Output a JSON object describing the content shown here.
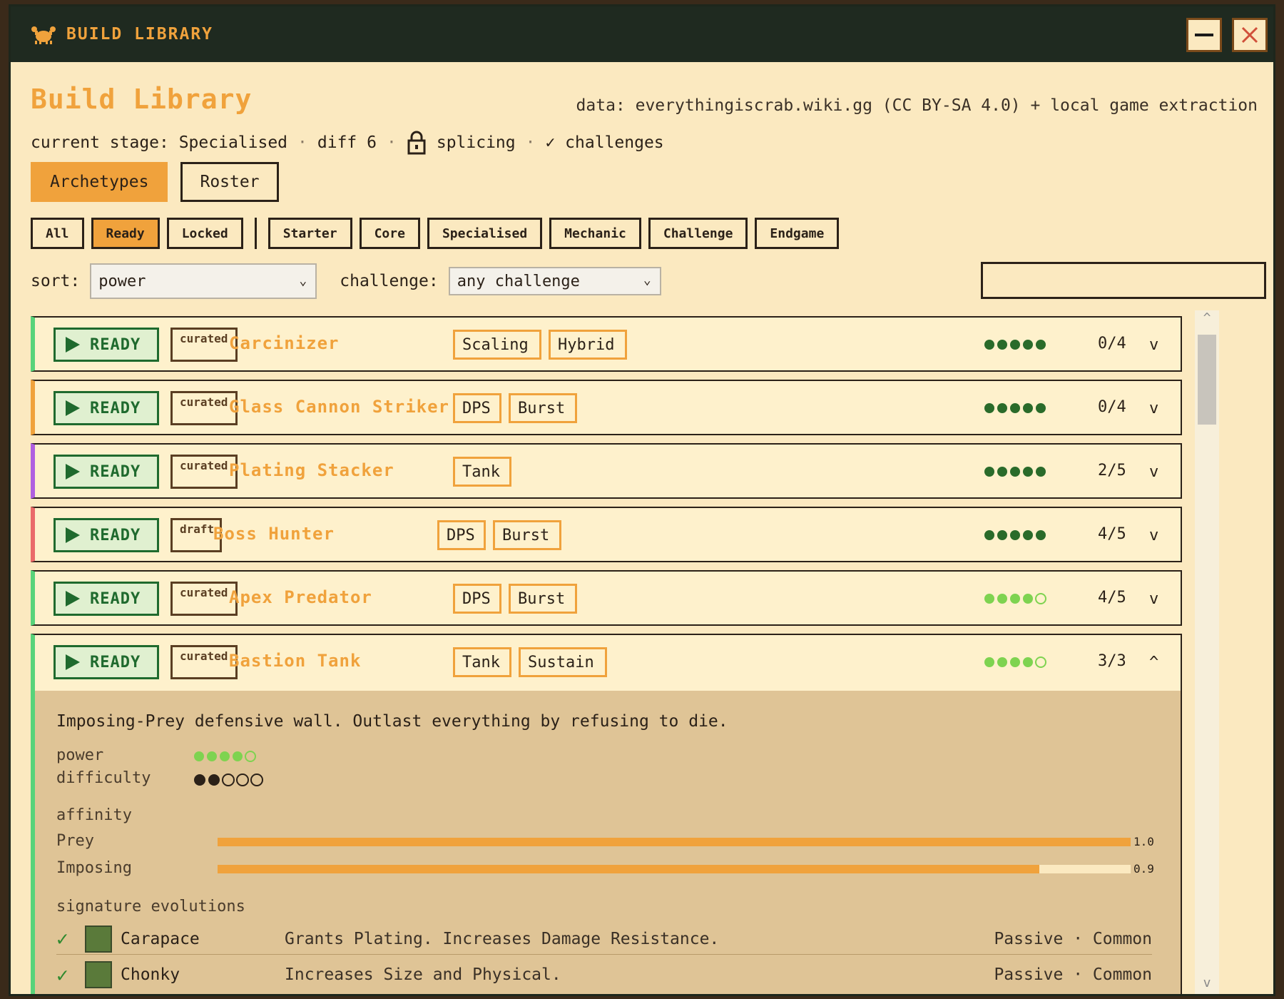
{
  "window": {
    "title": "BUILD LIBRARY",
    "min_label": "",
    "close_label": "✕"
  },
  "header": {
    "title": "Build Library",
    "data_source": "data: everythingiscrab.wiki.gg (CC BY-SA 4.0) + local game extraction",
    "stage": "current stage: Specialised",
    "diff": "diff 6",
    "splicing": "splicing",
    "challenges": "✓ challenges",
    "sep": "·"
  },
  "modetabs": [
    {
      "label": "Archetypes",
      "active": true
    },
    {
      "label": "Roster",
      "active": false
    }
  ],
  "filters": {
    "status": [
      {
        "label": "All",
        "active": false
      },
      {
        "label": "Ready",
        "active": true
      },
      {
        "label": "Locked",
        "active": false
      }
    ],
    "stages": [
      {
        "label": "Starter"
      },
      {
        "label": "Core"
      },
      {
        "label": "Specialised"
      },
      {
        "label": "Mechanic"
      },
      {
        "label": "Challenge"
      },
      {
        "label": "Endgame"
      }
    ]
  },
  "sort": {
    "label": "sort:",
    "value": "power",
    "challenge_label": "challenge:",
    "challenge_value": "any challenge",
    "search_value": ""
  },
  "colors": {
    "accent": "#f0a23c",
    "ready_green": "#1f6a2e",
    "dark": "#2b2118",
    "stars_dark": "#2a6b2a",
    "stars_light": "#7ed350"
  },
  "rows": [
    {
      "status": "READY",
      "tier": "curated",
      "name": "Carcinizer",
      "tags": [
        "Scaling",
        "Hybrid"
      ],
      "power": 5,
      "count": "0/4",
      "chevron": "v",
      "edge": "#58d37a"
    },
    {
      "status": "READY",
      "tier": "curated",
      "name": "Glass Cannon Striker",
      "tags": [
        "DPS",
        "Burst"
      ],
      "power": 5,
      "count": "0/4",
      "chevron": "v",
      "edge": "#f0a23c"
    },
    {
      "status": "READY",
      "tier": "curated",
      "name": "Plating Stacker",
      "tags": [
        "Tank"
      ],
      "power": 5,
      "count": "2/5",
      "chevron": "v",
      "edge": "#b060e0"
    },
    {
      "status": "READY",
      "tier": "draft",
      "name": "Boss Hunter",
      "tags": [
        "DPS",
        "Burst"
      ],
      "power": 5,
      "count": "4/5",
      "chevron": "v",
      "edge": "#ea6a6a"
    },
    {
      "status": "READY",
      "tier": "curated",
      "name": "Apex Predator",
      "tags": [
        "DPS",
        "Burst"
      ],
      "power": 4,
      "count": "4/5",
      "chevron": "v",
      "edge": "#58d37a"
    }
  ],
  "expanded": {
    "status": "READY",
    "tier": "curated",
    "name": "Bastion Tank",
    "tags": [
      "Tank",
      "Sustain"
    ],
    "power": 4,
    "count": "3/3",
    "chevron": "^",
    "edge": "#58d37a",
    "description": "Imposing-Prey defensive wall. Outlast everything by refusing to die.",
    "power_label": "power",
    "difficulty_label": "difficulty",
    "difficulty": 2,
    "affinity_label": "affinity",
    "affinity": [
      {
        "name": "Prey",
        "value": 1.0,
        "label": "1.0"
      },
      {
        "name": "Imposing",
        "value": 0.9,
        "label": "0.9"
      }
    ],
    "evolutions_label": "signature evolutions",
    "evolutions": [
      {
        "name": "Carapace",
        "desc": "Grants Plating. Increases Damage Resistance.",
        "type": "Passive · Common",
        "icon": "carapace-icon"
      },
      {
        "name": "Chonky",
        "desc": "Increases Size and Physical.",
        "type": "Passive · Common",
        "icon": "chonky-icon"
      }
    ]
  },
  "scrollbar": {
    "up": "^",
    "down": "v"
  }
}
